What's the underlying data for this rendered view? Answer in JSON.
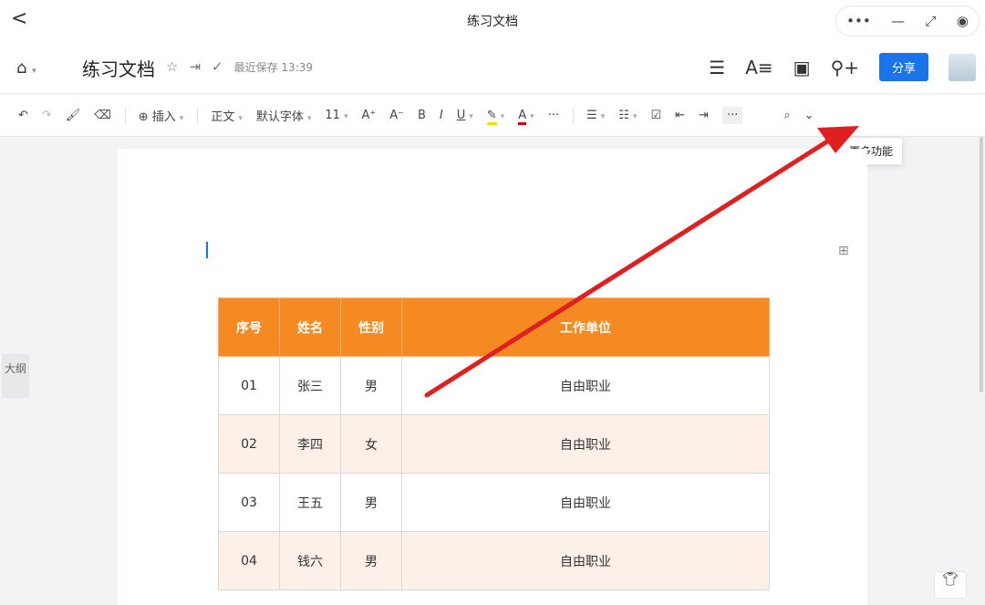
{
  "window": {
    "title": "练习文档",
    "controls": [
      "•••",
      "—",
      "⤢",
      "◉"
    ]
  },
  "header": {
    "title": "练习文档",
    "saved": "最近保存 13:39",
    "share": "分享"
  },
  "toolbar": {
    "insert": "插入",
    "style": "正文",
    "font": "默认字体",
    "size": "11",
    "more_tooltip": "更多功能"
  },
  "outline": "大纲",
  "table": {
    "headers": [
      "序号",
      "姓名",
      "性别",
      "工作单位"
    ],
    "rows": [
      [
        "01",
        "张三",
        "男",
        "自由职业"
      ],
      [
        "02",
        "李四",
        "女",
        "自由职业"
      ],
      [
        "03",
        "王五",
        "男",
        "自由职业"
      ],
      [
        "04",
        "钱六",
        "男",
        "自由职业"
      ]
    ]
  },
  "colors": {
    "header": "#f58a23",
    "accent": "#1a73e8",
    "arrow": "#e02020"
  }
}
